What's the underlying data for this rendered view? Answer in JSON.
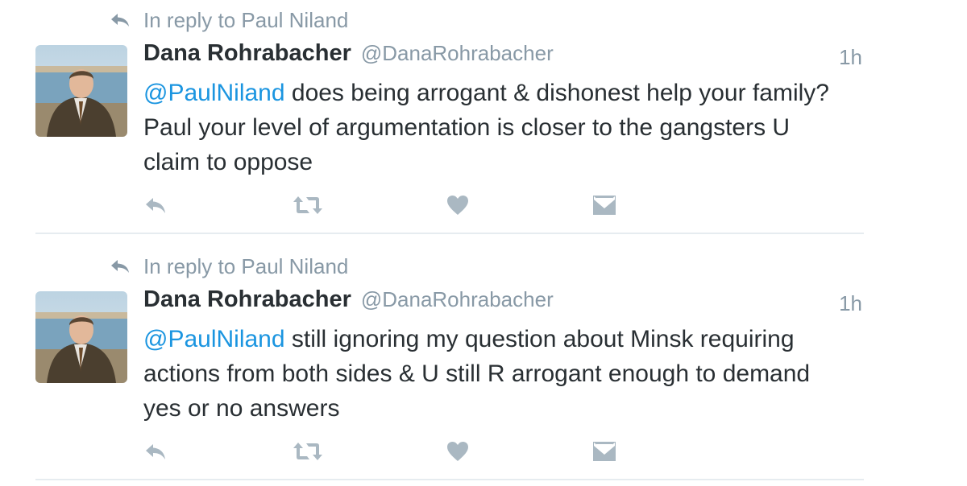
{
  "tweets": [
    {
      "reply_context": "In reply to Paul Niland",
      "author_name": "Dana Rohrabacher",
      "author_handle": "@DanaRohrabacher",
      "timestamp": "1h",
      "mention": "@PaulNiland",
      "text": " does being arrogant & dishonest help your family? Paul your level of argumentation is closer to the gangsters U claim to oppose"
    },
    {
      "reply_context": "In reply to Paul Niland",
      "author_name": "Dana Rohrabacher",
      "author_handle": "@DanaRohrabacher",
      "timestamp": "1h",
      "mention": "@PaulNiland",
      "text": " still ignoring my question about Minsk requiring actions from both sides & U still R arrogant enough to demand yes or no answers"
    }
  ],
  "icons": {
    "reply_context": "reply-arrow-icon",
    "reply": "reply-icon",
    "retweet": "retweet-icon",
    "like": "heart-icon",
    "dm": "envelope-icon"
  },
  "colors": {
    "mention": "#1b95e0",
    "meta_text": "#8899a6",
    "body_text": "#292f33",
    "action_icon": "#aab8c2",
    "divider": "#e6ecf0"
  }
}
